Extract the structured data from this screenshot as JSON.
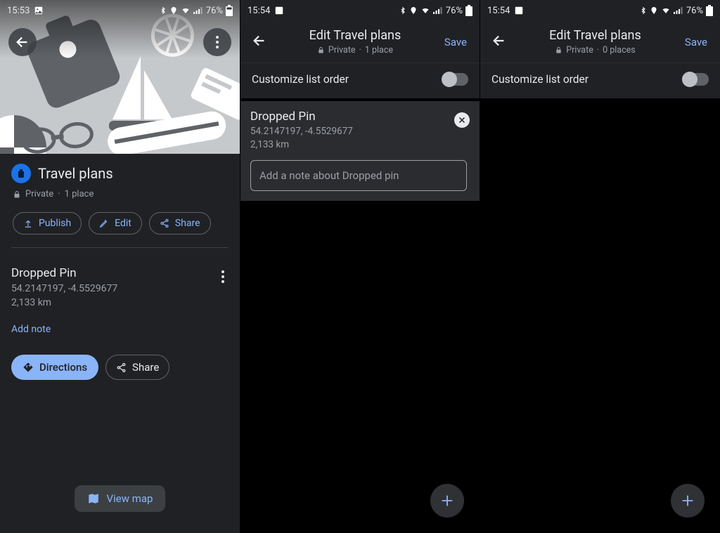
{
  "panel1": {
    "status": {
      "time": "15:53",
      "battery": "76%"
    },
    "back_icon": "back",
    "menu_icon": "more",
    "list": {
      "title": "Travel plans",
      "privacy": "Private",
      "count": "1 place",
      "publish": "Publish",
      "edit": "Edit",
      "share": "Share"
    },
    "place": {
      "title": "Dropped Pin",
      "coords": "54.2147197, -4.5529677",
      "distance": "2,133 km",
      "add_note": "Add note",
      "directions": "Directions",
      "share": "Share"
    },
    "view_map": "View map"
  },
  "panel2": {
    "status": {
      "time": "15:54",
      "battery": "76%"
    },
    "title": "Edit Travel plans",
    "privacy": "Private",
    "count": "1 place",
    "save": "Save",
    "customize": "Customize list order",
    "item": {
      "title": "Dropped Pin",
      "coords": "54.2147197, -4.5529677",
      "distance": "2,133 km",
      "note_placeholder": "Add a note about Dropped pin"
    }
  },
  "panel3": {
    "status": {
      "time": "15:54",
      "battery": "76%"
    },
    "title": "Edit Travel plans",
    "privacy": "Private",
    "count": "0 places",
    "save": "Save",
    "customize": "Customize list order"
  }
}
